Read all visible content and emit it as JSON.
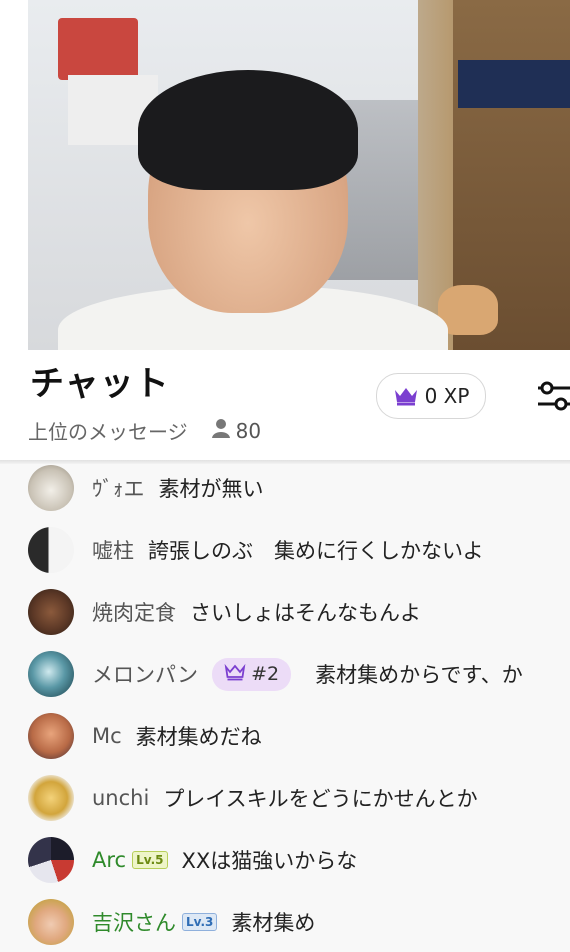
{
  "header": {
    "title": "チャット",
    "xp_label": "0 XP",
    "subtitle": "上位のメッセージ",
    "viewer_count": "80"
  },
  "colors": {
    "accent_purple": "#7b3fd0",
    "rank_badge_bg": "#ecdcf7",
    "username_green": "#2f8a2b"
  },
  "messages": [
    {
      "user": "ｳﾞｫエ",
      "text": "素材が無い"
    },
    {
      "user": "嘘柱",
      "text": "誇張しのぶ　集めに行くしかないよ"
    },
    {
      "user": "焼肉定食",
      "text": "さいしょはそんなもんよ"
    },
    {
      "user": "メロンパン",
      "rank": "#2",
      "text": "素材集めからです、か"
    },
    {
      "user": "Mc",
      "text": "素材集めだね"
    },
    {
      "user": "unchi",
      "text": "プレイスキルをどうにかせんとか"
    },
    {
      "user": "Arc",
      "level": "Lv.5",
      "text": "XXは猫強いからな"
    },
    {
      "user": "吉沢さん",
      "level": "Lv.3",
      "text": "素材集め"
    }
  ]
}
